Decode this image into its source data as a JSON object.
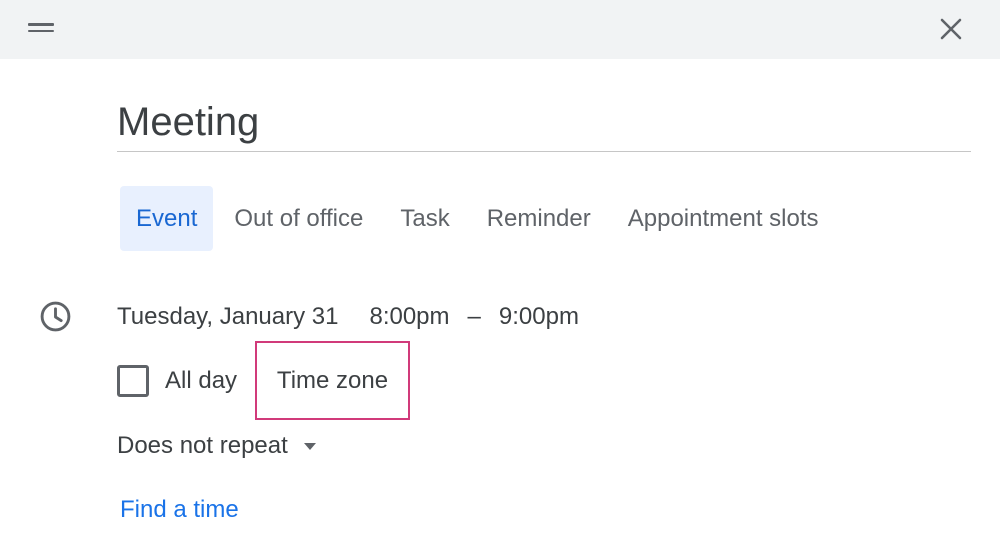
{
  "dialog": {
    "title": "Meeting"
  },
  "tabs": [
    {
      "label": "Event",
      "active": true
    },
    {
      "label": "Out of office",
      "active": false
    },
    {
      "label": "Task",
      "active": false
    },
    {
      "label": "Reminder",
      "active": false
    },
    {
      "label": "Appointment slots",
      "active": false
    }
  ],
  "datetime": {
    "date": "Tuesday, January 31",
    "start_time": "8:00pm",
    "separator": "–",
    "end_time": "9:00pm"
  },
  "all_day": {
    "label": "All day",
    "checked": false
  },
  "time_zone": {
    "label": "Time zone",
    "highlight_color": "#d13a7a"
  },
  "repeat": {
    "value": "Does not repeat"
  },
  "find_time": {
    "label": "Find a time"
  },
  "colors": {
    "accent": "#1a73e8",
    "active_tab_bg": "#e8f0fe",
    "active_tab_text": "#1967d2",
    "header_bg": "#f1f3f4"
  },
  "icons": {
    "drag": "drag-handle-icon",
    "close": "close-icon",
    "clock": "clock-icon",
    "dropdown": "dropdown-arrow-icon"
  }
}
